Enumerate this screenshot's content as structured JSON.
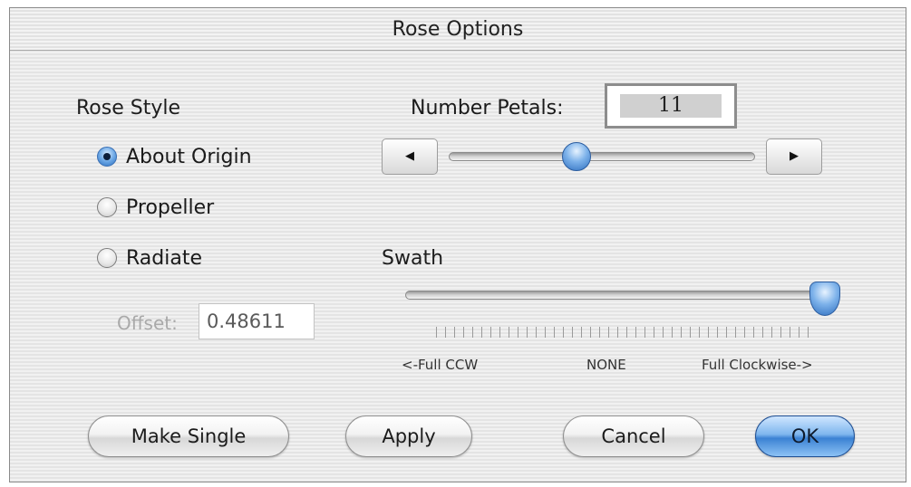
{
  "window": {
    "title": "Rose Options"
  },
  "rose_style": {
    "label": "Rose Style",
    "options": [
      {
        "label": "About Origin",
        "selected": true
      },
      {
        "label": "Propeller",
        "selected": false
      },
      {
        "label": "Radiate",
        "selected": false
      }
    ],
    "offset_label": "Offset:",
    "offset_value": "0.48611"
  },
  "petals": {
    "label": "Number Petals:",
    "value": "11",
    "slider_fraction": 0.41
  },
  "swath": {
    "label": "Swath",
    "slider_fraction": 1.0,
    "tick_labels": [
      "<-Full CCW",
      "NONE",
      "Full Clockwise->"
    ]
  },
  "buttons": {
    "make_single": "Make Single",
    "apply": "Apply",
    "cancel": "Cancel",
    "ok": "OK"
  },
  "colors": {
    "accent": "#3b82d3"
  },
  "icons": {
    "decrement": "left-arrow-icon",
    "increment": "right-arrow-icon"
  }
}
